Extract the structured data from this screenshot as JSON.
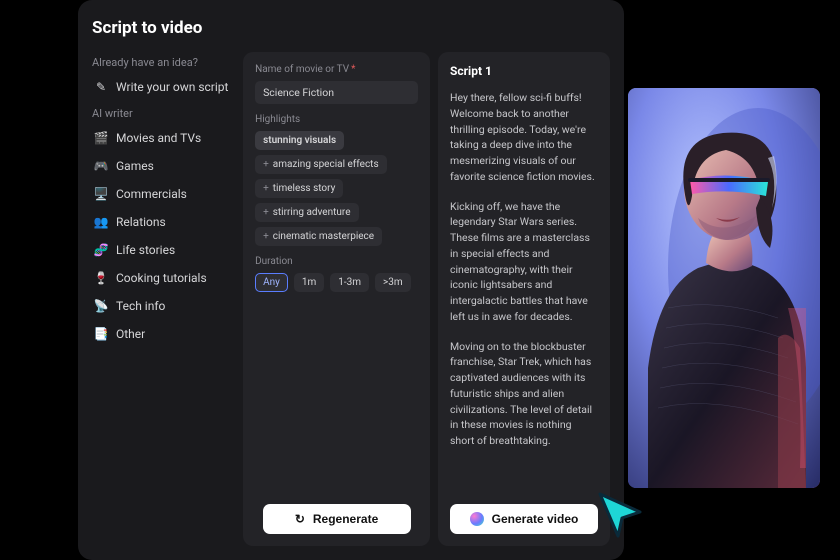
{
  "title": "Script to video",
  "sidebar": {
    "already_label": "Already have an idea?",
    "write_own": "Write your own script",
    "ai_writer_label": "AI writer",
    "items": [
      {
        "icon": "🎬",
        "label": "Movies and TVs"
      },
      {
        "icon": "🎮",
        "label": "Games"
      },
      {
        "icon": "🖥️",
        "label": "Commercials"
      },
      {
        "icon": "👥",
        "label": "Relations"
      },
      {
        "icon": "🧬",
        "label": "Life stories"
      },
      {
        "icon": "🍷",
        "label": "Cooking tutorials"
      },
      {
        "icon": "📡",
        "label": "Tech info"
      },
      {
        "icon": "📑",
        "label": "Other"
      }
    ]
  },
  "form": {
    "name_label": "Name of movie or TV",
    "name_value": "Science Fiction",
    "highlights_label": "Highlights",
    "highlight_fixed": "stunning visuals",
    "highlight_chips": [
      "amazing special effects",
      "timeless story",
      "stirring adventure",
      "cinematic masterpiece"
    ],
    "duration_label": "Duration",
    "durations": [
      "Any",
      "1m",
      "1-3m",
      ">3m"
    ],
    "regenerate": "Regenerate"
  },
  "script": {
    "heading": "Script 1",
    "p1": "Hey there, fellow sci-fi buffs! Welcome back to another thrilling episode. Today, we're taking a deep dive into the mesmerizing visuals of our favorite science fiction movies.",
    "p2": "Kicking off, we have the legendary Star Wars series. These films are a masterclass in special effects and cinematography, with their iconic lightsabers and intergalactic battles that have left us in awe for decades.",
    "p3": "Moving on to the blockbuster franchise, Star Trek, which has captivated audiences with its futuristic ships and alien civilizations. The level of detail in these movies is nothing short of breathtaking.",
    "generate": "Generate video"
  }
}
